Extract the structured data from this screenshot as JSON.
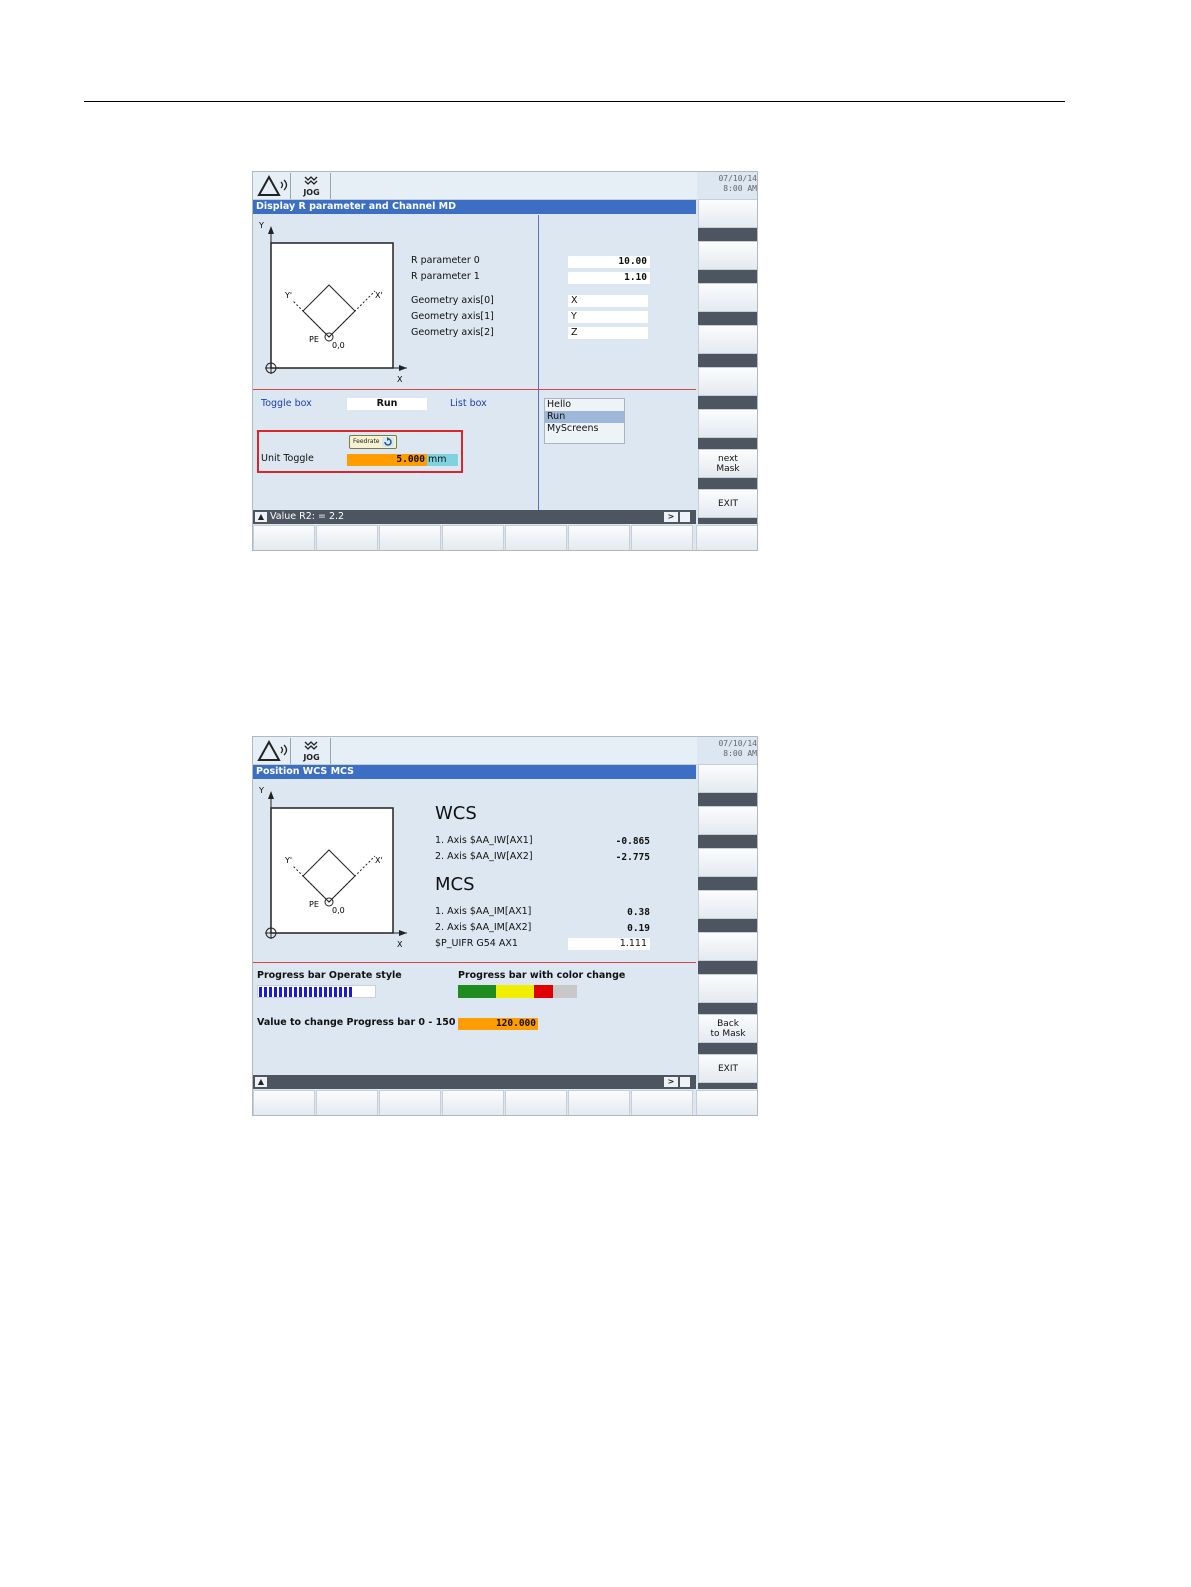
{
  "common": {
    "date": "07/10/14",
    "time": "8:00 AM",
    "mode": "JOG"
  },
  "screen1": {
    "title": "Display R parameter and Channel MD",
    "fields": [
      {
        "label": "R parameter 0",
        "value": "10.00"
      },
      {
        "label": "R parameter 1",
        "value": "1.10"
      }
    ],
    "axes": [
      {
        "label": "Geometry axis[0]",
        "value": "X"
      },
      {
        "label": "Geometry axis[1]",
        "value": "Y"
      },
      {
        "label": "Geometry axis[2]",
        "value": "Z"
      }
    ],
    "diagram": {
      "y": "Y",
      "x": "X",
      "y_rot": "Y'",
      "x_rot": "X'",
      "pe": "PE",
      "origin": "0,0"
    },
    "toggle_label": "Toggle box",
    "toggle_value": "Run",
    "listbox_label": "List box",
    "listbox_items": [
      "Hello",
      "Run",
      "MyScreens"
    ],
    "feedrate_button": "Feedrate",
    "unit_toggle_label": "Unit Toggle",
    "unit_toggle_value": "5.000",
    "unit_toggle_unit": "mm",
    "status_text": "Value R2: = 2.2",
    "softkeys": {
      "next_mask": [
        "next",
        "Mask"
      ],
      "exit": "EXIT"
    }
  },
  "screen2": {
    "title": "Position WCS MCS",
    "wcs_title": "WCS",
    "wcs": [
      {
        "label": "1. Axis $AA_IW[AX1]",
        "value": "-0.865"
      },
      {
        "label": "2. Axis $AA_IW[AX2]",
        "value": "-2.775"
      }
    ],
    "mcs_title": "MCS",
    "mcs": [
      {
        "label": "1. Axis $AA_IM[AX1]",
        "value": "0.38"
      },
      {
        "label": "2. Axis $AA_IM[AX2]",
        "value": "0.19"
      }
    ],
    "uifr_label": "$P_UIFR G54 AX1",
    "uifr_value": "1.111",
    "diagram": {
      "y": "Y",
      "x": "X",
      "y_rot": "Y'",
      "x_rot": "X'",
      "pe": "PE",
      "origin": "0,0"
    },
    "progress1_label": "Progress bar Operate style",
    "progress1_fraction": 0.8,
    "progress2_label": "Progress bar with color change",
    "progress2_fraction": 0.8,
    "progress2_colors": [
      "#1e8c1e",
      "#f2ee00",
      "#e00000",
      "#c8c8c8"
    ],
    "value_label": "Value to change Progress bar 0 - 150",
    "value": "120.000",
    "softkeys": {
      "back_to_mask": [
        "Back",
        "to Mask"
      ],
      "exit": "EXIT"
    }
  }
}
